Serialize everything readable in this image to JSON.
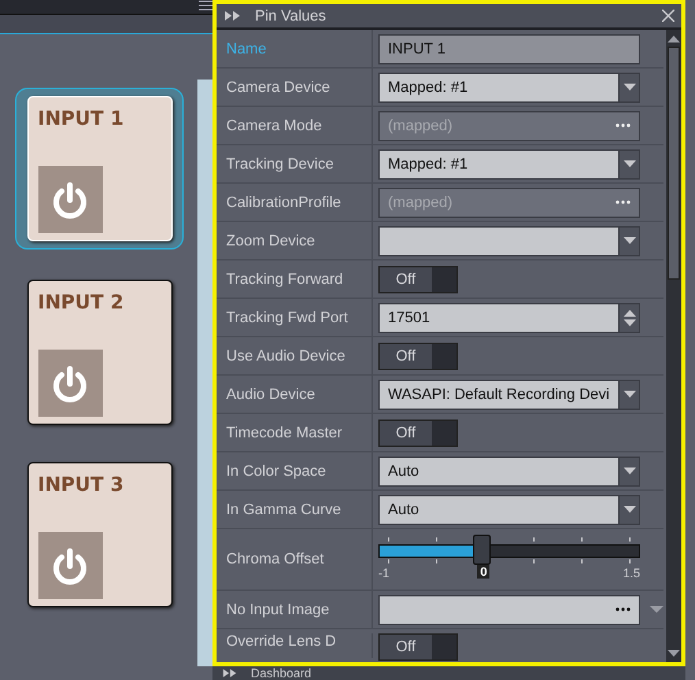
{
  "cards": [
    {
      "label": "INPUT 1",
      "selected": true
    },
    {
      "label": "INPUT 2",
      "selected": false
    },
    {
      "label": "INPUT 3",
      "selected": false
    }
  ],
  "panel": {
    "title": "Pin Values",
    "rows": [
      {
        "label": "Name",
        "kind": "text",
        "value": "INPUT 1",
        "selected": true
      },
      {
        "label": "Camera Device",
        "kind": "dropdown",
        "value": "Mapped: #1",
        "selected": false
      },
      {
        "label": "Camera Mode",
        "kind": "browse",
        "value": "(mapped)",
        "disabled": true,
        "selected": false
      },
      {
        "label": "Tracking Device",
        "kind": "dropdown",
        "value": "Mapped: #1",
        "selected": false
      },
      {
        "label": "CalibrationProfile",
        "kind": "browse",
        "value": "(mapped)",
        "disabled": true,
        "selected": false
      },
      {
        "label": "Zoom Device",
        "kind": "dropdown",
        "selected": false
      },
      {
        "label": "Tracking Forward",
        "kind": "toggle",
        "value": "Off",
        "on": false,
        "selected": false
      },
      {
        "label": "Tracking Fwd Port",
        "kind": "spinner",
        "value": "17501",
        "selected": false
      },
      {
        "label": "Use Audio Device",
        "kind": "toggle",
        "value": "Off",
        "on": false,
        "selected": false
      },
      {
        "label": "Audio Device",
        "kind": "dropdown",
        "value": "WASAPI: Default Recording Devi",
        "selected": false
      },
      {
        "label": "Timecode Master",
        "kind": "toggle",
        "value": "Off",
        "on": false,
        "selected": false
      },
      {
        "label": "In Color Space",
        "kind": "dropdown",
        "value": "Auto",
        "selected": false
      },
      {
        "label": "In Gamma Curve",
        "kind": "dropdown",
        "value": "Auto",
        "selected": false
      },
      {
        "label": "Chroma Offset",
        "kind": "slider",
        "level": 0.4,
        "min": "-1",
        "reading": "0",
        "max": "1.5",
        "selected": false
      },
      {
        "label": "No Input Image",
        "kind": "file",
        "selected": false
      },
      {
        "label": "Override Lens D",
        "kind": "toggle",
        "value": "Off",
        "on": false,
        "selected": false
      }
    ]
  },
  "bottom_panel": {
    "title": "Dashboard"
  }
}
